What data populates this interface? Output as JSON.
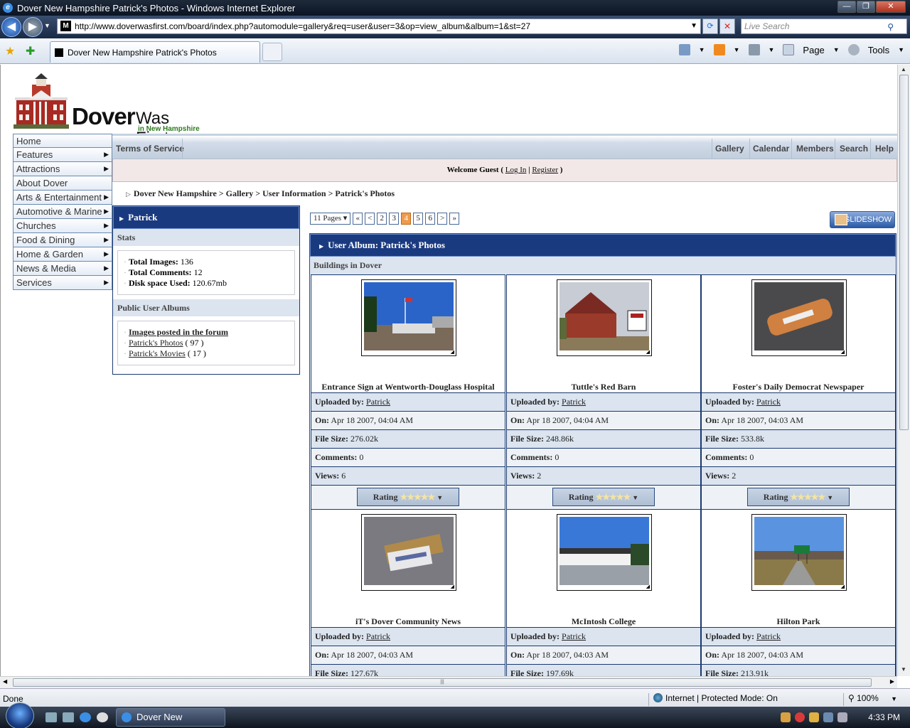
{
  "window": {
    "title": "Dover New Hampshire Patrick's Photos - Windows Internet Explorer",
    "url": "http://www.doverwasfirst.com/board/index.php?automodule=gallery&req=user&user=3&op=view_album&album=1&st=27",
    "search_placeholder": "Live Search",
    "tab_title": "Dover New Hampshire Patrick's Photos",
    "tools": {
      "page": "Page",
      "tools": "Tools"
    }
  },
  "status": {
    "left": "Done",
    "zone": "Internet | Protected Mode: On",
    "zoom": "100%"
  },
  "taskbar": {
    "item": "Dover New Hampsh...",
    "clock": "4:33 PM"
  },
  "site": {
    "logo": {
      "main": "Dover",
      "rest": "Was First",
      "sub": "in New Hampshire"
    },
    "sidenav": [
      {
        "label": "Home",
        "arrow": ""
      },
      {
        "label": "Features",
        "arrow": "▶"
      },
      {
        "label": "Attractions",
        "arrow": "▶"
      },
      {
        "label": "About Dover",
        "arrow": ""
      },
      {
        "label": "Arts & Entertainment",
        "arrow": "▶"
      },
      {
        "label": "Automotive & Marine",
        "arrow": "▶"
      },
      {
        "label": "Churches",
        "arrow": "▶"
      },
      {
        "label": "Food & Dining",
        "arrow": "▶"
      },
      {
        "label": "Home & Garden",
        "arrow": "▶"
      },
      {
        "label": "News & Media",
        "arrow": "▶"
      },
      {
        "label": "Services",
        "arrow": "▶"
      }
    ],
    "topnav": {
      "left": "Terms of Service",
      "gallery": "Gallery",
      "calendar": "Calendar",
      "members": "Members",
      "search": "Search",
      "help": "Help"
    },
    "welcome": {
      "prefix": "Welcome Guest ( ",
      "login": "Log In",
      "sep": " | ",
      "register": "Register",
      "suffix": " )"
    },
    "breadcrumb": "Dover New Hampshire > Gallery > User Information > Patrick's Photos"
  },
  "profile": {
    "name": "Patrick",
    "stats_title": "Stats",
    "stats": [
      {
        "label": "Total Images:",
        "value": "136"
      },
      {
        "label": "Total Comments:",
        "value": "12"
      },
      {
        "label": "Disk space Used:",
        "value": "120.67mb"
      }
    ],
    "albums_title": "Public User Albums",
    "albums": [
      {
        "label": "Images posted in the forum",
        "count": ""
      },
      {
        "label": "Patrick's Photos",
        "count": "( 97 )"
      },
      {
        "label": "Patrick's Movies",
        "count": "( 17 )"
      }
    ]
  },
  "pager": {
    "pages_label": "11 Pages ▾",
    "first": "«",
    "prev": "<",
    "pages": [
      "2",
      "3",
      "4",
      "5",
      "6"
    ],
    "current": "4",
    "next": ">",
    "last": "»",
    "slideshow": "SLIDESHOW"
  },
  "album": {
    "title": "User Album: Patrick's Photos",
    "category": "Buildings in Dover",
    "labels": {
      "uploaded": "Uploaded by:",
      "on": "On:",
      "size": "File Size:",
      "comments": "Comments:",
      "views": "Views:",
      "rating": "Rating"
    },
    "photos": [
      {
        "caption": "Entrance Sign at Wentworth-Douglass Hospital",
        "user": "Patrick",
        "on": "Apr 18 2007, 04:04 AM",
        "size": "276.02k",
        "comments": "0",
        "views": "6"
      },
      {
        "caption": "Tuttle's Red Barn",
        "user": "Patrick",
        "on": "Apr 18 2007, 04:04 AM",
        "size": "248.86k",
        "comments": "0",
        "views": "2"
      },
      {
        "caption": "Foster's Daily Democrat Newspaper",
        "user": "Patrick",
        "on": "Apr 18 2007, 04:03 AM",
        "size": "533.8k",
        "comments": "0",
        "views": "2"
      },
      {
        "caption": "iT's Dover Community News",
        "user": "Patrick",
        "on": "Apr 18 2007, 04:03 AM",
        "size": "127.67k"
      },
      {
        "caption": "McIntosh College",
        "user": "Patrick",
        "on": "Apr 18 2007, 04:03 AM",
        "size": "197.69k"
      },
      {
        "caption": "Hilton Park",
        "user": "Patrick",
        "on": "Apr 18 2007, 04:03 AM",
        "size": "213.91k"
      }
    ]
  }
}
